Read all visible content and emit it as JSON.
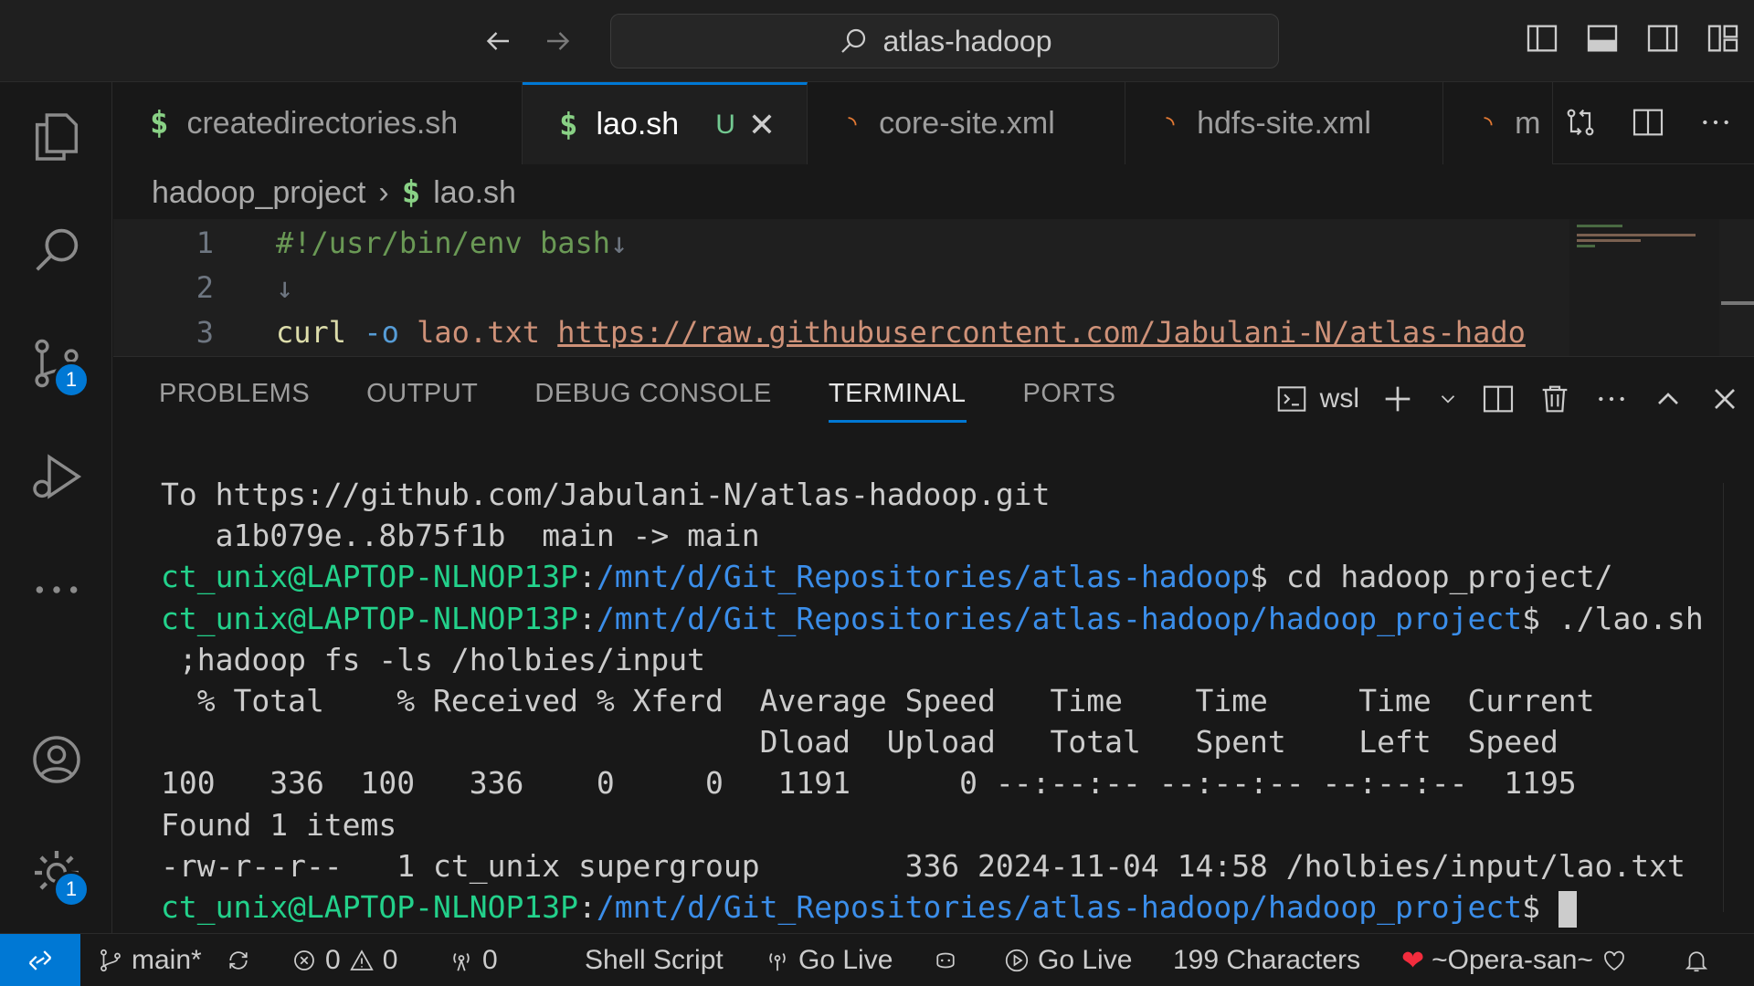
{
  "titlebar": {
    "search_text": "atlas-hadoop"
  },
  "tabs": [
    {
      "label": "createdirectories.sh",
      "icon": "$",
      "type": "sh"
    },
    {
      "label": "lao.sh",
      "icon": "$",
      "type": "sh",
      "status": "U",
      "active": true
    },
    {
      "label": "core-site.xml",
      "icon": "rss-icon",
      "type": "xml"
    },
    {
      "label": "hdfs-site.xml",
      "icon": "rss-icon",
      "type": "xml"
    },
    {
      "label": "m",
      "icon": "rss-icon",
      "type": "xml"
    }
  ],
  "breadcrumb": {
    "folder": "hadoop_project",
    "file_icon": "$",
    "file": "lao.sh"
  },
  "editor": {
    "lines": [
      {
        "num": "1",
        "text": "#!/usr/bin/env bash",
        "eol": "↓"
      },
      {
        "num": "2",
        "text": "",
        "eol": "↓"
      },
      {
        "num": "3",
        "cmd": "curl",
        "flag": "-o",
        "arg": "lao.txt",
        "url": "https://raw.githubusercontent.com/Jabulani-N/atlas-hado"
      }
    ]
  },
  "panel": {
    "tabs": [
      "PROBLEMS",
      "OUTPUT",
      "DEBUG CONSOLE",
      "TERMINAL",
      "PORTS"
    ],
    "active_tab": "TERMINAL",
    "shell": "wsl"
  },
  "terminal": {
    "lines": [
      "To https://github.com/Jabulani-N/atlas-hadoop.git",
      "   a1b079e..8b75f1b  main -> main",
      {
        "user": "ct_unix@LAPTOP-NLNOP13P",
        "path": "/mnt/d/Git_Repositories/atlas-hadoop",
        "cmd": "$ cd hadoop_project/"
      },
      {
        "user": "ct_unix@LAPTOP-NLNOP13P",
        "path": "/mnt/d/Git_Repositories/atlas-hadoop/hadoop_project",
        "cmd": "$ ./lao.sh"
      },
      " ;hadoop fs -ls /holbies/input",
      "  % Total    % Received % Xferd  Average Speed   Time    Time     Time  Current",
      "                                 Dload  Upload   Total   Spent    Left  Speed",
      "100   336  100   336    0     0   1191      0 --:--:-- --:--:-- --:--:--  1195",
      "Found 1 items",
      "-rw-r--r--   1 ct_unix supergroup        336 2024-11-04 14:58 /holbies/input/lao.txt",
      {
        "user": "ct_unix@LAPTOP-NLNOP13P",
        "path": "/mnt/d/Git_Repositories/atlas-hadoop/hadoop_project",
        "cmd": "$ "
      }
    ]
  },
  "statusbar": {
    "branch": "main*",
    "errors": "0",
    "warnings": "0",
    "ports": "0",
    "language": "Shell Script",
    "go_live_1": "Go Live",
    "go_live_2": "Go Live",
    "characters": "199 Characters",
    "user": "~Opera-san~"
  },
  "badges": {
    "source_control": "1",
    "settings": "1"
  },
  "colors": {
    "accent": "#0078d4",
    "terminal_user": "#23d18b",
    "terminal_path": "#3b8eea"
  }
}
